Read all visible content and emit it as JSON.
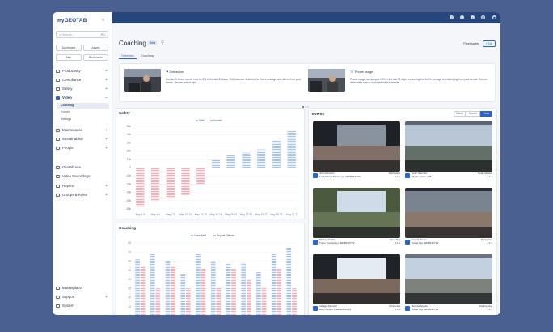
{
  "sidebar": {
    "logo": "myGEOTAB",
    "search_placeholder": "Search",
    "search_shortcut": "⌘K",
    "quick": [
      "Dashboard",
      "Assets",
      "Map",
      "Bookmarks"
    ],
    "nav": [
      {
        "label": "Productivity",
        "icon": "productivity-icon"
      },
      {
        "label": "Compliance",
        "icon": "compliance-icon"
      },
      {
        "label": "Safety",
        "icon": "safety-icon"
      },
      {
        "label": "Video",
        "icon": "video-icon",
        "active": true
      },
      {
        "label": "Maintenance",
        "icon": "maintenance-icon"
      },
      {
        "label": "Sustainability",
        "icon": "sustainability-icon"
      },
      {
        "label": "People",
        "icon": "people-icon"
      },
      {
        "label": "Geotab Ace",
        "icon": "ace-icon"
      },
      {
        "label": "Video Recordings",
        "icon": "recordings-icon"
      },
      {
        "label": "Reports",
        "icon": "reports-icon"
      },
      {
        "label": "Groups & Rules",
        "icon": "groups-icon"
      }
    ],
    "video_sub": [
      "Coaching",
      "Events",
      "Settings"
    ],
    "bottom": [
      "Marketplace",
      "Support",
      "System"
    ]
  },
  "page": {
    "title": "Coaching",
    "badge": "Beta",
    "tabs": [
      "Overview",
      "Coaching"
    ],
    "top_right_label": "Fleet safety",
    "top_right_button": "+ Edit"
  },
  "insights": [
    {
      "title": "Distraction",
      "desc": "Hands-off wheel events rose by 8% in the last 30 days. This increase is above the fleet's average and differs from past trends. Review recent trips."
    },
    {
      "title": "Phone usage",
      "desc": "Phone usage has jumped 10% in the last 30 days, exceeding the fleet's average and diverging from past trends. Review driver data now to avoid potential incidents."
    }
  ],
  "events": {
    "title": "Events",
    "ranges": [
      "Week",
      "Month",
      "Year"
    ],
    "items": [
      {
        "name": "Juan Ramirez",
        "detail": "Ford Transit Passenger 3EFBR3ZYZ3",
        "type": "Distraction",
        "count": "1.1 s"
      },
      {
        "name": "Noah Sanchez",
        "detail": "Mighty Hauler 328",
        "type": "Near collision",
        "count": "1.1 s"
      },
      {
        "name": "Michael Smith",
        "detail": "Turbo Transporter 3EFBR3ZYZ3",
        "type": "Speeding",
        "count": "1.1 s"
      },
      {
        "name": "Sophia Brown",
        "detail": "Power Rig 3EFBR3ZYZ3",
        "type": "Distraction",
        "count": "1.1 s"
      },
      {
        "name": "Indiago Ramirez",
        "detail": "Daily Hustler F 3EFBR3ZYZ3",
        "type": "Distracted",
        "count": "1.1 s"
      },
      {
        "name": "Jessica Garcia",
        "detail": "Power Rig 3EFBR3ZYZ3",
        "type": "Rolling stop",
        "count": "1.1 s"
      }
    ]
  },
  "colors": {
    "safe": "#a9c4ec",
    "unsafe": "#f1aeb9",
    "accent": "#2c64c8",
    "topbar": "#25477b"
  },
  "chart_data": [
    {
      "type": "bar",
      "title": "Safety",
      "categories": [
        "May 1-5",
        "May 4-6",
        "May 7-9",
        "May 10-12",
        "May 13-15",
        "May 16-18",
        "May 19-21",
        "May 22-24",
        "May 25-27",
        "May 28-30",
        "May 31-2"
      ],
      "series": [
        {
          "name": "Safe",
          "values": [
            0,
            0,
            0,
            0,
            0,
            10,
            15,
            18,
            22,
            33,
            45
          ]
        },
        {
          "name": "Unsafe",
          "values": [
            -48,
            -40,
            -37,
            -33,
            -20,
            0,
            0,
            0,
            0,
            0,
            0
          ]
        }
      ],
      "ylim": [
        -50,
        50
      ],
      "yticks": [
        "50k",
        "40k",
        "30k",
        "20k",
        "10k",
        "0",
        "-10k",
        "-20k",
        "-30k",
        "-40k",
        "-50k"
      ]
    },
    {
      "type": "bar",
      "title": "Coaching",
      "categories": [
        "May 1-3",
        "May 4-6",
        "May 7-9",
        "May 10-12",
        "May 13-15",
        "May 16-18",
        "May 19-21",
        "May 22-24",
        "May 25-27",
        "May 28-30",
        "May 31-2"
      ],
      "series": [
        {
          "name": "Voice Alert",
          "values": [
            62,
            68,
            61,
            46,
            68,
            60,
            57,
            58,
            48,
            68,
            75
          ]
        },
        {
          "name": "Repeat Offense",
          "values": [
            55,
            30,
            55,
            30,
            52,
            31,
            52,
            40,
            31,
            52,
            30
          ]
        }
      ],
      "ylim": [
        0,
        80
      ],
      "yticks": [
        "80",
        "70",
        "60",
        "50",
        "40",
        "30",
        "20",
        "10",
        "0"
      ]
    }
  ]
}
